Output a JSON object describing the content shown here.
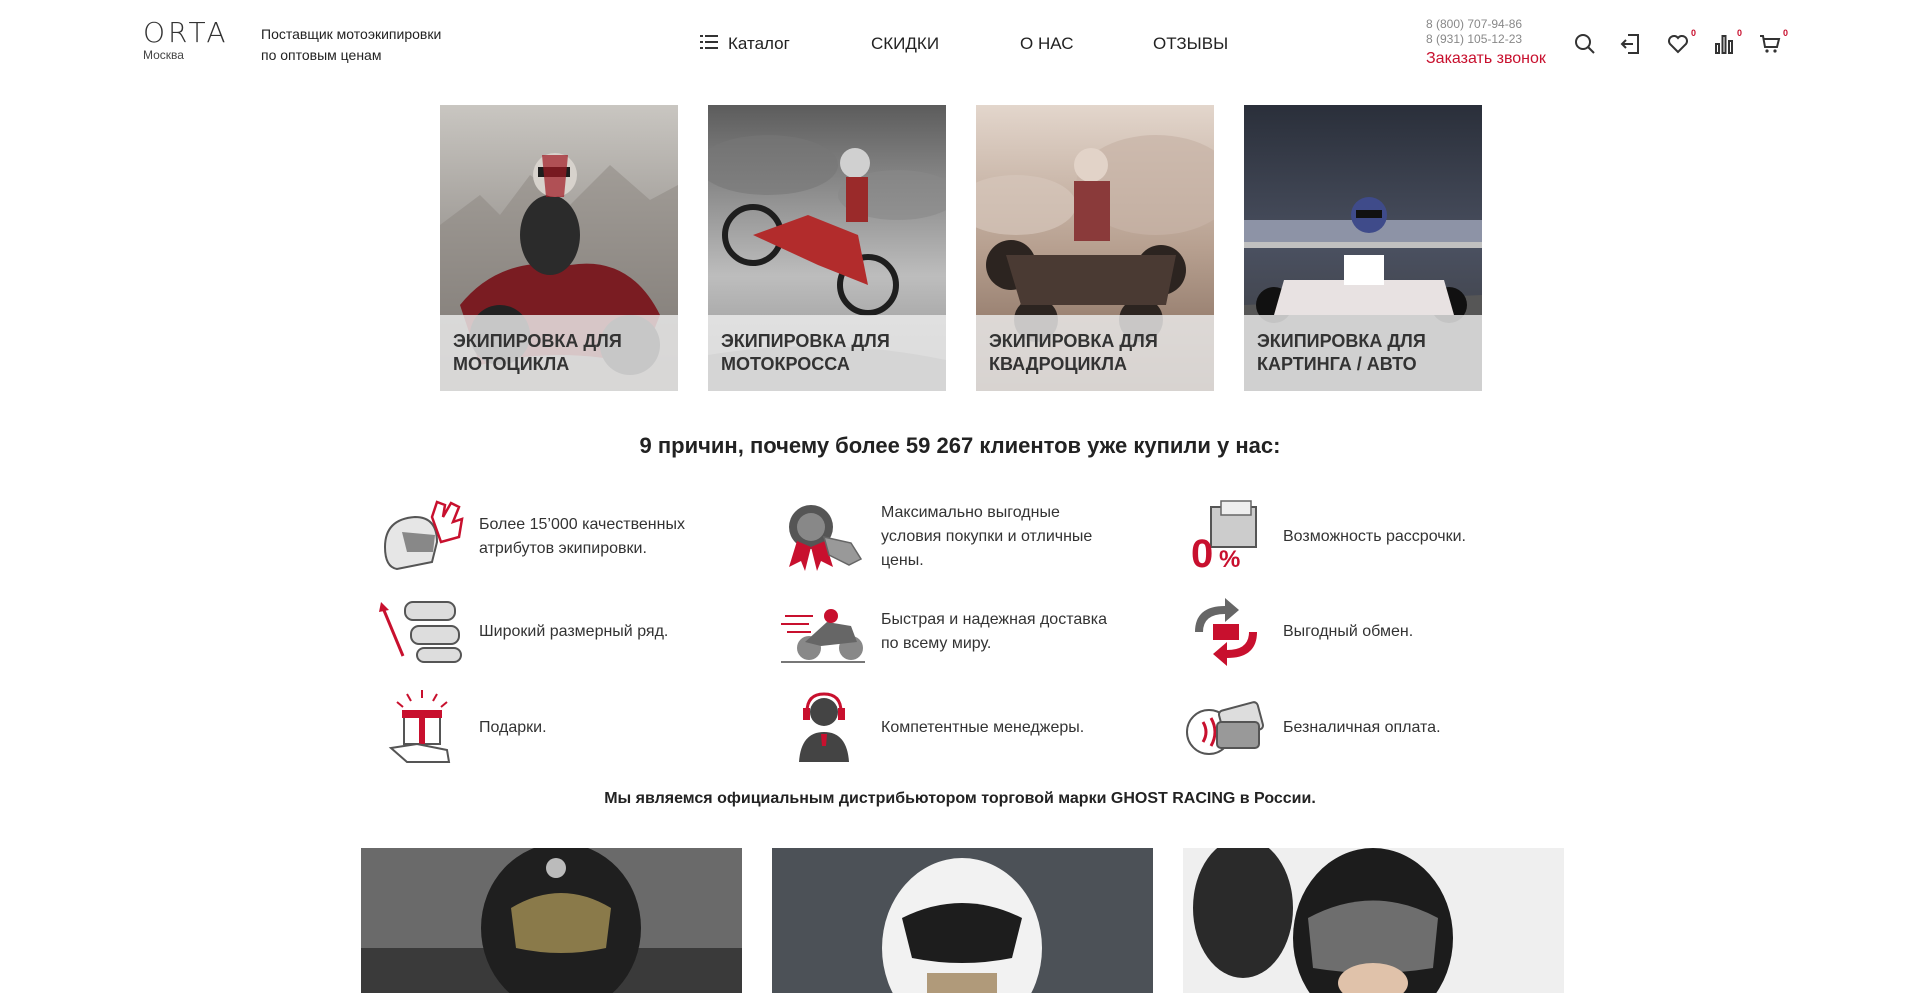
{
  "header": {
    "logo": "ORTA",
    "city": "Москва",
    "tagline_line1": "Поставщик мотоэкипировки",
    "tagline_line2": "по оптовым ценам",
    "nav": {
      "catalog": "Каталог",
      "discounts": "СКИДКИ",
      "about": "О НАС",
      "reviews": "ОТЗЫВЫ"
    },
    "phone1": "8 (800) 707-94-86",
    "phone2": "8 (931) 105-12-23",
    "callback": "Заказать звонок",
    "badges": {
      "favorites": "0",
      "compare": "0",
      "cart": "0"
    },
    "icons": [
      "menu-icon",
      "search-icon",
      "login-icon",
      "heart-icon",
      "compare-icon",
      "cart-icon"
    ]
  },
  "categories": [
    {
      "label": "ЭКИПИРОВКА ДЛЯ МОТОЦИКЛА"
    },
    {
      "label": "ЭКИПИРОВКА ДЛЯ МОТОКРОССА"
    },
    {
      "label": "ЭКИПИРОВКА ДЛЯ КВАДРОЦИКЛА"
    },
    {
      "label": "ЭКИПИРОВКА ДЛЯ КАРТИНГА / АВТО"
    }
  ],
  "reasons": {
    "title": "9 причин, почему более 59 267 клиентов уже купили у нас:",
    "items": [
      {
        "text": "Более 15’000 качественных атрибутов экипировки.",
        "icon": "helmet-gloves-icon"
      },
      {
        "text": "Максимально выгодные условия покупки и отличные цены.",
        "icon": "award-tag-icon"
      },
      {
        "text": "Возможность рассрочки.",
        "icon": "zero-percent-wallet-icon"
      },
      {
        "text": "Широкий размерный ряд.",
        "icon": "goggles-size-icon"
      },
      {
        "text": "Быстрая и надежная доставка по всему миру.",
        "icon": "fast-motorcycle-icon"
      },
      {
        "text": "Выгодный обмен.",
        "icon": "exchange-arrows-icon"
      },
      {
        "text": "Подарки.",
        "icon": "gift-hand-icon"
      },
      {
        "text": "Компетентные менеджеры.",
        "icon": "manager-headset-icon"
      },
      {
        "text": "Безналичная оплата.",
        "icon": "contactless-card-icon"
      }
    ]
  },
  "distributor": "Мы являемся официальным дистрибьютором торговой марки GHOST RACING в России.",
  "colors": {
    "accent": "#c8102e",
    "text": "#222222",
    "muted": "#888888"
  }
}
